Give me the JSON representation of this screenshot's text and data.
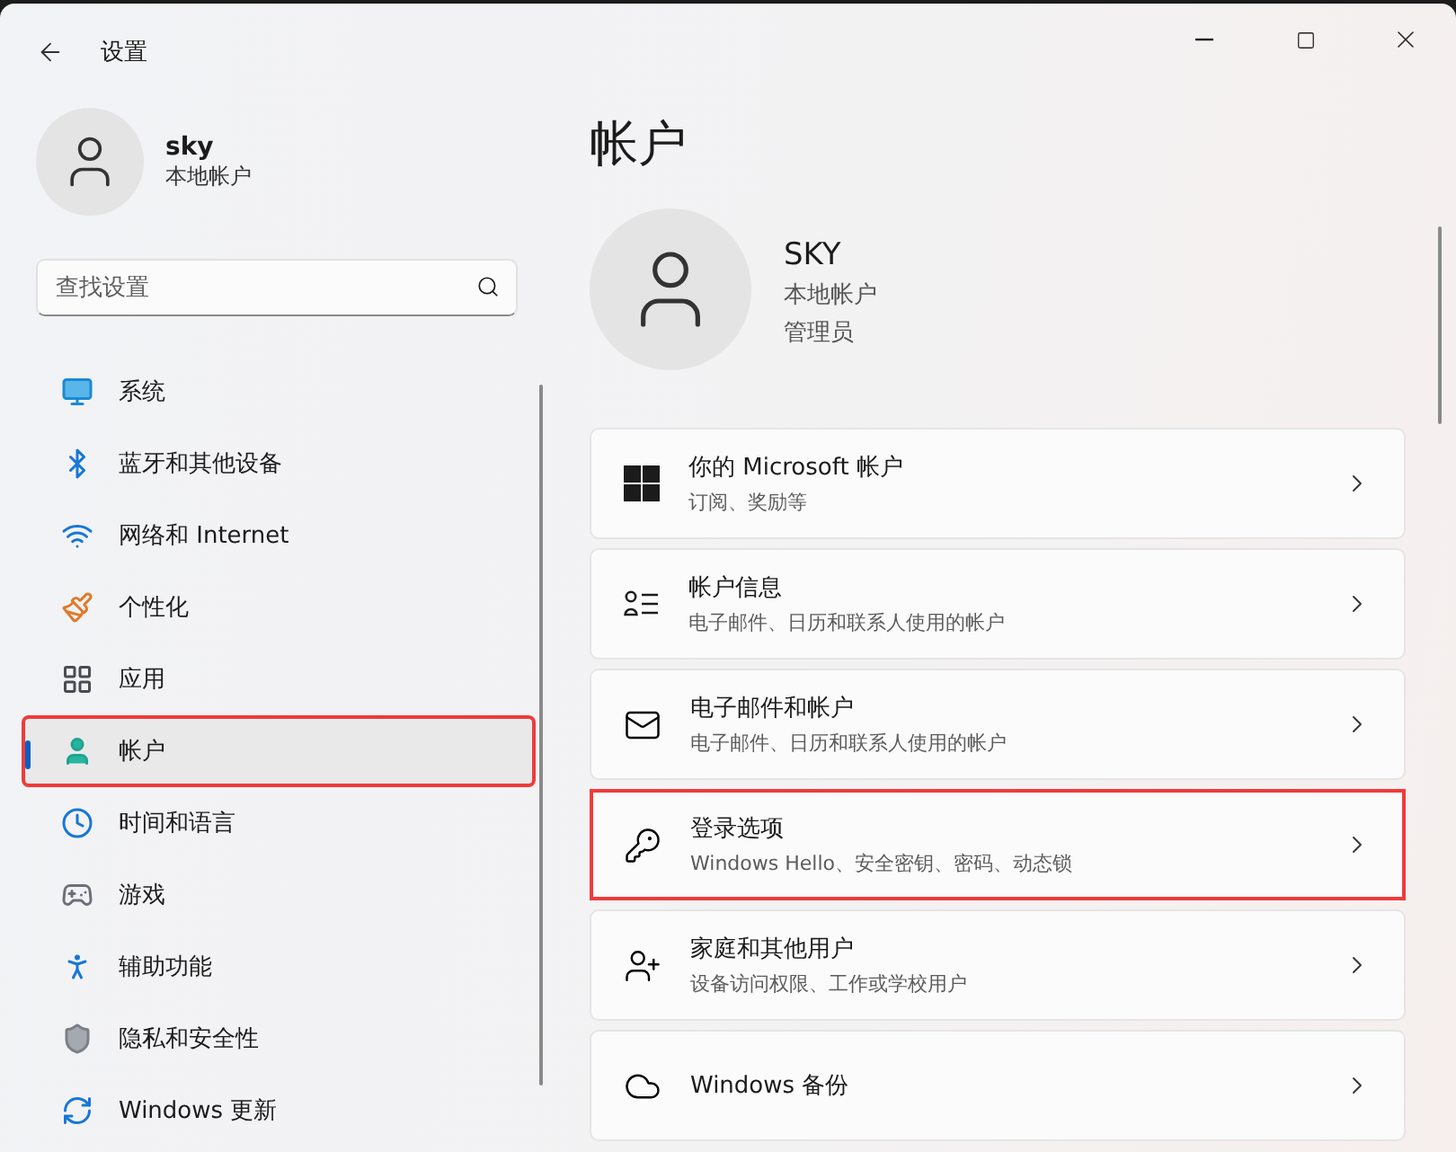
{
  "window": {
    "title": "设置"
  },
  "user": {
    "name": "sky",
    "account_type": "本地帐户"
  },
  "search": {
    "placeholder": "查找设置"
  },
  "nav": [
    {
      "kind": "system",
      "label": "系统",
      "selected": false,
      "highlighted": false
    },
    {
      "kind": "bluetooth",
      "label": "蓝牙和其他设备",
      "selected": false,
      "highlighted": false
    },
    {
      "kind": "network",
      "label": "网络和 Internet",
      "selected": false,
      "highlighted": false
    },
    {
      "kind": "personalize",
      "label": "个性化",
      "selected": false,
      "highlighted": false
    },
    {
      "kind": "apps",
      "label": "应用",
      "selected": false,
      "highlighted": false
    },
    {
      "kind": "accounts",
      "label": "帐户",
      "selected": true,
      "highlighted": true
    },
    {
      "kind": "time",
      "label": "时间和语言",
      "selected": false,
      "highlighted": false
    },
    {
      "kind": "gaming",
      "label": "游戏",
      "selected": false,
      "highlighted": false
    },
    {
      "kind": "accessibility",
      "label": "辅助功能",
      "selected": false,
      "highlighted": false
    },
    {
      "kind": "privacy",
      "label": "隐私和安全性",
      "selected": false,
      "highlighted": false
    },
    {
      "kind": "update",
      "label": "Windows 更新",
      "selected": false,
      "highlighted": false
    }
  ],
  "page": {
    "title": "帐户"
  },
  "profile": {
    "name": "SKY",
    "account_type": "本地帐户",
    "role": "管理员"
  },
  "cards": [
    {
      "kind": "microsoft",
      "title": "你的 Microsoft 帐户",
      "subtitle": "订阅、奖励等",
      "highlighted": false
    },
    {
      "kind": "info",
      "title": "帐户信息",
      "subtitle": "电子邮件、日历和联系人使用的帐户",
      "highlighted": false
    },
    {
      "kind": "email",
      "title": "电子邮件和帐户",
      "subtitle": "电子邮件、日历和联系人使用的帐户",
      "highlighted": false
    },
    {
      "kind": "signin",
      "title": "登录选项",
      "subtitle": "Windows Hello、安全密钥、密码、动态锁",
      "highlighted": true
    },
    {
      "kind": "family",
      "title": "家庭和其他用户",
      "subtitle": "设备访问权限、工作或学校用户",
      "highlighted": false
    },
    {
      "kind": "backup",
      "title": "Windows 备份",
      "highlighted": false
    }
  ]
}
